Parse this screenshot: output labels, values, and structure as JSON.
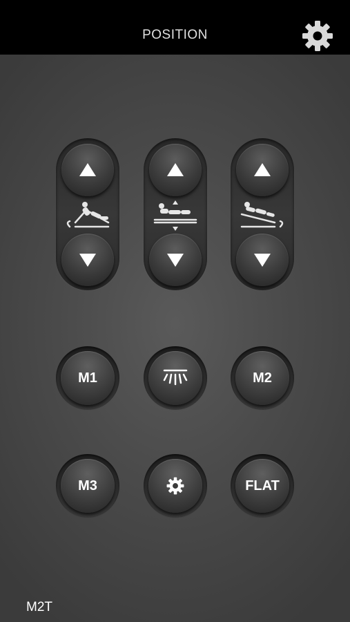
{
  "header": {
    "title": "POSITION",
    "settings_icon": "gear-icon"
  },
  "controls": {
    "head": {
      "up_icon": "triangle-up-icon",
      "down_icon": "triangle-down-icon",
      "icon": "bed-head-tilt-icon"
    },
    "lift": {
      "up_icon": "triangle-up-icon",
      "down_icon": "triangle-down-icon",
      "icon": "bed-lift-icon"
    },
    "foot": {
      "up_icon": "triangle-up-icon",
      "down_icon": "triangle-down-icon",
      "icon": "bed-foot-tilt-icon"
    }
  },
  "presets": {
    "m1": "M1",
    "light_icon": "underbed-light-icon",
    "m2": "M2",
    "m3": "M3",
    "settings_icon": "gear-icon",
    "flat": "FLAT"
  },
  "footer": {
    "device_label": "M2T"
  },
  "colors": {
    "topbar": "#000000",
    "background": "#4b4b4b",
    "text": "#ffffff"
  }
}
